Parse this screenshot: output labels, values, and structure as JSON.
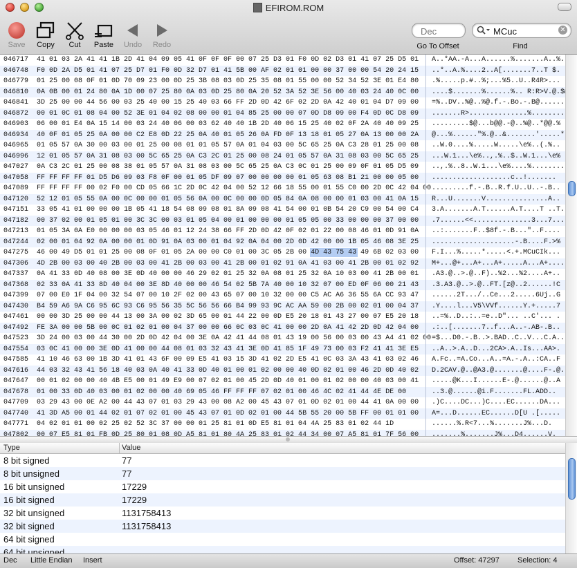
{
  "window": {
    "title": "EFIROM.ROM"
  },
  "toolbar": {
    "save": "Save",
    "copy": "Copy",
    "cut": "Cut",
    "paste": "Paste",
    "undo": "Undo",
    "redo": "Redo",
    "offset_placeholder": "Dec",
    "offset_label": "Go To Offset",
    "find_value": "MCuc",
    "find_label": "Find"
  },
  "hex": {
    "rows": [
      {
        "off": "046717",
        "hex": "41 01 03 2A 41 41 1B 2D 41 04 09 05 41 0F 0F 0F 00 07 25 D3 01 F0 0D 02 D3 01 41 07 25 D5 01",
        "asc": "A..*AA.-A...A......%.......A..%."
      },
      {
        "off": "046748",
        "hex": "F0 0D 2A D5 01 41 07 25 D7 01 F0 0D 32 D7 01 41 5B 00 AF 02 01 01 00 00 37 00 00 54 20 24 15",
        "asc": "..*..A.%....2..A[.......7..T $."
      },
      {
        "off": "046779",
        "hex": "01 25 00 08 0F 01 0D 70 09 23 00 0D 25 3B 08 03 0D 25 35 08 01 55 00 00 52 34 52 3E 01 E4 80",
        "asc": ".%.....p.#..%;...%5..U..R4R>..."
      },
      {
        "off": "046810",
        "hex": "0A 0B 00 01 24 80 0A 1D 00 07 25 80 0A 03 0D 25 80 0A 20 52 3A 52 3E 56 00 40 03 24 40 0C 00",
        "asc": "....$.......%......%.. R:R>V.@.$@.."
      },
      {
        "off": "046841",
        "hex": "3D 25 00 00 44 56 00 03 25 40 00 15 25 40 03 66 FF 2D 0D 42 6F 02 2D 0A 42 40 01 04 D7 09 00",
        "asc": "=%..DV..%@..%@.f.-.Bo.-.B@......"
      },
      {
        "off": "046872",
        "hex": "00 01 0C 01 08 04 00 52 3E 01 04 02 08 00 00 01 04 85 25 00 00 07 0D D8 09 00 F4 0D 0C D8 09",
        "asc": ".......R>..............%........."
      },
      {
        "off": "046903",
        "hex": "06 00 01 E4 0A 15 14 00 03 24 40 06 00 03 62 40 40 1B 2D 40 06 15 25 40 02 0F 2A 40 40 09 25",
        "asc": ".........$@...b@@.-@..%@..*@@.%"
      },
      {
        "off": "046934",
        "hex": "40 0F 01 05 25 0A 00 00 C2 E8 0D 22 25 0A 40 01 05 26 0A FD 0F 13 18 01 05 27 0A 13 00 00 2A",
        "asc": "@...%......\"%.@..&.......'.....*"
      },
      {
        "off": "046965",
        "hex": "01 05 57 0A 30 00 03 00 01 25 00 08 01 01 05 57 0A 01 04 03 00 5C 65 25 0A C3 28 01 25 00 08",
        "asc": "..W.0....%.....W.....\\e%..(.%.."
      },
      {
        "off": "046996",
        "hex": "12 01 05 57 0A 31 08 03 00 5C 65 25 0A C3 2C 01 25 00 08 24 01 05 57 0A 31 08 03 00 5C 65 25",
        "asc": "...W.1...\\e%..,.%..$..W.1...\\e%"
      },
      {
        "off": "047027",
        "hex": "0A C3 2C 01 25 00 08 38 01 05 57 0A 31 08 03 00 5C 65 25 0A C3 0C 01 25 00 09 0F 01 05 D5 09",
        "asc": "..,.%..8..W.1...\\e%....%........"
      },
      {
        "off": "047058",
        "hex": "FF FF FF FF 01 D5 D6 09 03 F8 0F 00 01 05 DF 09 07 00 00 00 00 01 05 63 08 B1 21 00 00 05 00",
        "asc": "...................c..!......."
      },
      {
        "off": "047089",
        "hex": "FF FF FF FF 00 02 F0 00 CD 05 66 1C 2D 0C 42 04 00 52 12 66 18 55 00 01 55 C0 00 2D 0C 42 04 00",
        "asc": ".........f.-.B..R.f.U..U..-.B.."
      },
      {
        "off": "047120",
        "hex": "52 12 01 05 55 0A 00 0C 00 00 01 05 56 0A 00 0C 00 00 0D 05 84 0A 08 00 00 01 03 00 41 0A 15",
        "asc": "R...U.......V...............A.."
      },
      {
        "off": "047151",
        "hex": "33 05 41 01 00 00 00 1B 05 41 18 54 08 09 08 01 8A 09 08 41 54 00 01 0B 54 20 C9 00 54 00 C4",
        "asc": "3.A.......A.T......A.T....T ..T.."
      },
      {
        "off": "047182",
        "hex": "00 37 02 00 01 05 01 00 3C 3C 00 03 01 05 04 00 01 00 00 00 01 05 05 00 33 00 00 00 37 00 00",
        "asc": ".7......<<..............3...7..."
      },
      {
        "off": "047213",
        "hex": "01 05 3A 0A E0 00 00 00 03 05 46 01 12 24 38 66 FF 2D 0D 42 0F 02 01 22 00 08 46 01 0D 91 0A",
        "asc": "..:.......F..$8f.-.B...\"..F...."
      },
      {
        "off": "047244",
        "hex": "02 00 01 04 92 0A 00 00 01 0D 91 0A 03 00 01 04 92 0A 04 00 2D 0D 42 00 00 1B 05 46 08 3E 25",
        "asc": "....................-.B....F.>%"
      },
      {
        "off": "047275",
        "hex": "46 00 49 D5 01 01 25 00 08 0F 01 05 2A 00 00 C0 01 00 3C 05 2B 00 4D 43 75 43 49 6B 02 03 00",
        "asc": "F.I...%.....*.....<.+.MCuCIk..."
      },
      {
        "off": "047306",
        "hex": "4D 2B 00 03 00 40 2B 00 03 00 41 2B 00 03 00 41 2B 00 01 02 91 0A 41 03 00 41 2B 00 01 02 92",
        "asc": "M+...@+...A+...A+.....A...A+...."
      },
      {
        "off": "047337",
        "hex": "0A 41 33 0D 40 08 00 3E 0D 40 00 00 46 29 02 01 25 32 0A 08 01 25 32 0A 10 03 00 41 2B 00 01",
        "asc": ".A3.@..>.@..F)..%2...%2....A+.."
      },
      {
        "off": "047368",
        "hex": "02 33 0A 41 33 8D 40 04 00 3E 8D 40 00 00 46 54 02 5B 7A 40 00 10 32 07 00 ED 0F 06 00 21 43",
        "asc": ".3.A3.@..>.@..FT.[z@..2......!C"
      },
      {
        "off": "047399",
        "hex": "07 00 E0 1F 04 00 32 54 07 00 10 2F 02 00 43 65 07 00 10 32 00 00 C5 AC A6 36 55 6A CC 93 47",
        "asc": "......2T.../..Ce...2.....6Uj..G"
      },
      {
        "off": "047430",
        "hex": "B4 59 A6 9A C6 95 6C 93 C6 95 56 35 5C 56 56 66 B4 99 93 9C AC AA 59 00 2B 00 02 01 00 04 37",
        "asc": ".Y....l...V5\\VVf......Y.+.....7"
      },
      {
        "off": "047461",
        "hex": "00 00 3D 25 00 00 44 13 00 3A 00 02 3D 65 00 01 44 22 00 0D E5 20 18 01 43 27 00 07 E5 20 18",
        "asc": "..=%..D..:..=e..D\"... ..C'... ."
      },
      {
        "off": "047492",
        "hex": "FE 3A 00 00 5B 00 0C 01 02 01 00 04 37 00 00 66 0C 03 0C 41 00 00 2D 0A 41 42 2D 0D 42 04 00",
        "asc": ".:..[.......7..f...A..-.AB-.B.."
      },
      {
        "off": "047523",
        "hex": "3D 24 00 03 00 44 30 00 2D 0D 42 04 00 3E 0A 42 41 44 08 01 43 19 00 56 00 03 00 43 A4 41 02 00",
        "asc": "=$...D0.-.B..>.BAD..C..V...C.A.."
      },
      {
        "off": "047554",
        "hex": "03 0C 41 00 00 3E 0D 41 00 00 44 08 01 03 32 43 41 3E 0D 41 85 1F 49 73 00 03 F2 41 41 3E E5",
        "asc": "..A..>.A..D...2CA>.A..Is...AA>."
      },
      {
        "off": "047585",
        "hex": "41 10 46 63 00 1B 3D 41 01 43 6F 00 09 E5 41 03 15 3D 41 02 2D E5 41 0C 03 3A 43 41 03 02 46",
        "asc": "A.Fc..=A.Co...A..=A.-.A..:CA..F"
      },
      {
        "off": "047616",
        "hex": "44 03 32 43 41 56 18 40 03 0A 40 41 33 0D 40 01 00 01 02 00 00 40 0D 02 01 00 46 2D 0D 40 02",
        "asc": "D.2CAV.@..@A3.@.......@....F-.@."
      },
      {
        "off": "047647",
        "hex": "00 01 02 00 00 40 4B E5 00 01 49 E9 00 07 02 01 00 45 2D 0D 40 01 00 01 02 00 00 40 03 00 41",
        "asc": ".....@K...I......E-.@......@..A"
      },
      {
        "off": "047678",
        "hex": "01 00 33 0D 40 03 00 01 02 00 00 40 69 05 46 FF FF FF 07 02 01 00 46 4C 02 41 44 4E DE 00",
        "asc": "..3.@......@i.F.......FL.ADD.."
      },
      {
        "off": "047709",
        "hex": "03 29 43 00 0E A2 00 44 43 07 01 03 29 43 00 08 A2 00 45 43 07 01 0D 02 01 00 44 41 0A 00 00",
        "asc": ".)C....DC...)C....EC......DA..."
      },
      {
        "off": "047740",
        "hex": "41 3D A5 00 01 44 02 01 07 02 01 00 45 43 07 01 0D 02 01 00 44 5B 55 20 00 5B FF 00 01 01 00",
        "asc": "A=...D......EC......D[U .[....."
      },
      {
        "off": "047771",
        "hex": "04 02 01 01 00 02 25 02 52 3C 37 00 00 01 25 81 01 0D E5 81 01 04 4A 25 83 01 02 44 1D",
        "asc": "......%.R<7...%.......J%...D."
      },
      {
        "off": "047802",
        "hex": "00 07 E5 81 01 FB 0D 25 80 01 08 0D A5 81 01 80 4A 25 83 01 02 44 34 00 07 A5 81 01 7F 56 00",
        "asc": ".......%.......J%...D4......V."
      },
      {
        "off": "047833",
        "hex": "41 03 21 41 02 15 0D 41 04 03 00 40 80 01 09 05 40 0B 0C F0 FF 0F 02 40 41 03 79 41 02 15 15",
        "asc": "A.!A...A...@....@......@A.yA..."
      },
      {
        "off": "047864",
        "hex": "41 04 0F 52 40 41 4B E5 01 01 44 73 00 0F 25 40 04 01 02 80 01 40 07 05 82 01 00 00 00 FC 56",
        "asc": "A..R@AK...Ds..%@......@.......V"
      },
      {
        "off": "047895",
        "hex": "00 41 03 29 41 02 15 05 41 0E 0D 02 02 41 41 56 00 41 03 31 41 02 15 05 41 0B 0D 02 82 01 41",
        "asc": ".A.)A...A....AAV.A.1A...A....A"
      }
    ]
  },
  "types_table": {
    "headers": {
      "type": "Type",
      "value": "Value"
    },
    "rows": [
      {
        "type": "8 bit signed",
        "value": "77"
      },
      {
        "type": "8 bit unsigned",
        "value": "77"
      },
      {
        "type": "16 bit unsigned",
        "value": "17229"
      },
      {
        "type": "16 bit signed",
        "value": "17229"
      },
      {
        "type": "32 bit unsigned",
        "value": "1131758413"
      },
      {
        "type": "32 bit signed",
        "value": "1131758413"
      },
      {
        "type": "64 bit signed",
        "value": ""
      },
      {
        "type": "64 bit unsigned",
        "value": ""
      }
    ]
  },
  "status": {
    "mode": "Dec",
    "endian": "Little Endian",
    "insert": "Insert",
    "offset": "Offset: 47297",
    "selection": "Selection: 4"
  }
}
